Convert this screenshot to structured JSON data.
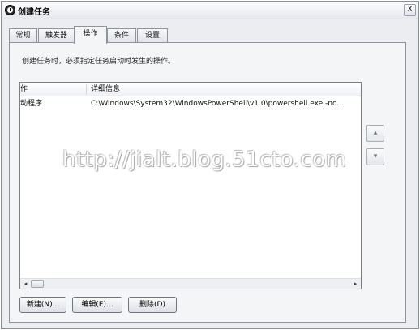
{
  "window": {
    "title": "创建任务",
    "close_label": "X"
  },
  "tabs": [
    {
      "label": "常规"
    },
    {
      "label": "触发器"
    },
    {
      "label": "操作"
    },
    {
      "label": "条件"
    },
    {
      "label": "设置"
    }
  ],
  "panel": {
    "description": "创建任务时，必须指定任务启动时发生的操作。"
  },
  "listview": {
    "columns": [
      "作",
      "详细信息"
    ],
    "rows": [
      {
        "action": "动程序",
        "details": "C:\\Windows\\System32\\WindowsPowerShell\\v1.0\\powershell.exe -no..."
      }
    ],
    "scroll_left": "◂",
    "scroll_right": "▸"
  },
  "side_buttons": {
    "up": "▴",
    "down": "▾"
  },
  "buttons": {
    "new": "新建(N)...",
    "edit": "编辑(E)...",
    "delete": "删除(D)"
  },
  "watermark": "http://jialt.blog.51cto.com"
}
